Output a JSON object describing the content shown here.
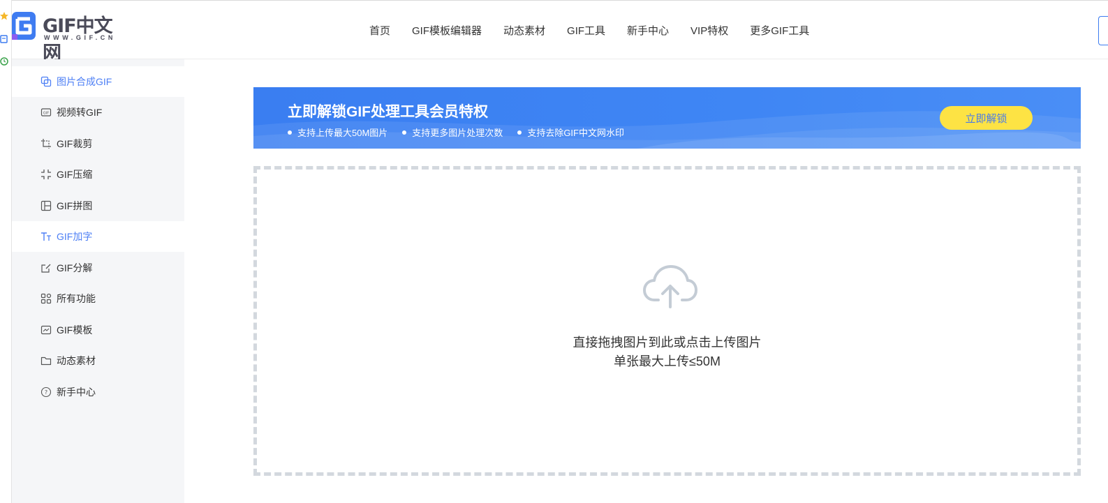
{
  "brand": {
    "name": "GIF中文网",
    "domain": "WWW.GIF.CN",
    "colors": {
      "primary": "#3d7cf0",
      "accent": "#fde344",
      "sidebar_bg": "#f5f6f8"
    }
  },
  "nav": {
    "items": [
      "首页",
      "GIF模板编辑器",
      "动态素材",
      "GIF工具",
      "新手中心",
      "VIP特权",
      "更多GIF工具"
    ]
  },
  "sidebar": {
    "items": [
      {
        "label": "图片合成GIF",
        "icon": "images-merge-icon",
        "active": true
      },
      {
        "label": "视频转GIF",
        "icon": "video-gif-icon",
        "active": false
      },
      {
        "label": "GIF裁剪",
        "icon": "crop-icon",
        "active": false
      },
      {
        "label": "GIF压缩",
        "icon": "compress-icon",
        "active": false
      },
      {
        "label": "GIF拼图",
        "icon": "collage-icon",
        "active": false
      },
      {
        "label": "GIF加字",
        "icon": "text-icon",
        "active": true
      },
      {
        "label": "GIF分解",
        "icon": "edit-split-icon",
        "active": false
      },
      {
        "label": "所有功能",
        "icon": "grid-icon",
        "active": false
      },
      {
        "label": "GIF模板",
        "icon": "template-icon",
        "active": false
      },
      {
        "label": "动态素材",
        "icon": "folder-icon",
        "active": false
      },
      {
        "label": "新手中心",
        "icon": "help-icon",
        "active": false
      }
    ]
  },
  "banner": {
    "title": "立即解锁GIF处理工具会员特权",
    "features": [
      "支持上传最大50M图片",
      "支持更多图片处理次数",
      "支持去除GIF中文网水印"
    ],
    "button": "立即解锁"
  },
  "upload": {
    "hint": "直接拖拽图片到此或点击上传图片",
    "limit": "单张最大上传≤50M",
    "icon": "cloud-upload-icon"
  }
}
